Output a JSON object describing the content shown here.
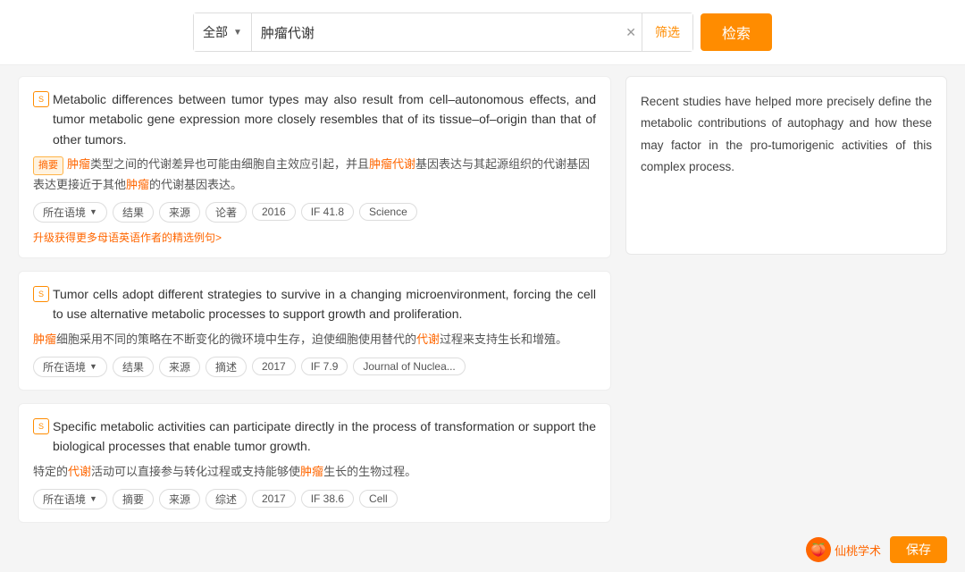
{
  "search": {
    "type_label": "全部",
    "query_value": "肿瘤代谢",
    "filter_label": "筛选",
    "submit_label": "检索"
  },
  "results": [
    {
      "id": 1,
      "icon": "S",
      "english": {
        "parts": [
          {
            "text": "Metabolic",
            "type": "orange"
          },
          {
            "text": " differences between ",
            "type": "normal"
          },
          {
            "text": "tumor",
            "type": "orange"
          },
          {
            "text": " types may also result from cell–autonomous effects, and ",
            "type": "normal"
          },
          {
            "text": "tumor",
            "type": "orange"
          },
          {
            "text": " ",
            "type": "normal"
          },
          {
            "text": "metabolic",
            "type": "orange"
          },
          {
            "text": " gene expression more closely resembles that of its tissue–of–origin than that of other ",
            "type": "normal"
          },
          {
            "text": "tumors.",
            "type": "orange"
          }
        ]
      },
      "chinese": {
        "prefix": "摘要",
        "parts": [
          {
            "text": "肿瘤",
            "type": "orange"
          },
          {
            "text": "类型之间的代谢差异也可能由细胞自主效应引起，并且",
            "type": "normal"
          },
          {
            "text": "肿瘤代谢",
            "type": "orange"
          },
          {
            "text": "基因表达与其起源组织的代谢基因表达更接近于其他",
            "type": "normal"
          },
          {
            "text": "肿瘤",
            "type": "orange"
          },
          {
            "text": "的代谢基因表达。",
            "type": "normal"
          }
        ]
      },
      "tags": [
        {
          "label": "所在语境",
          "has_arrow": true
        },
        {
          "label": "结果",
          "has_arrow": false
        },
        {
          "label": "来源",
          "has_arrow": false
        },
        {
          "label": "论著",
          "has_arrow": false
        },
        {
          "label": "2016",
          "has_arrow": false
        },
        {
          "label": "IF 41.8",
          "has_arrow": false
        },
        {
          "label": "Science",
          "has_arrow": false
        }
      ],
      "upgrade_tip": "升级获得更多母语英语作者的精选例句>"
    },
    {
      "id": 2,
      "icon": "S",
      "english": {
        "parts": [
          {
            "text": "Tumor",
            "type": "orange"
          },
          {
            "text": " cells adopt different strategies to survive in a changing microenvironment, forcing the cell to use alternative ",
            "type": "normal"
          },
          {
            "text": "metabolic processes",
            "type": "orange"
          },
          {
            "text": " to support growth and proliferation.",
            "type": "normal"
          }
        ]
      },
      "chinese": {
        "prefix": null,
        "parts": [
          {
            "text": "肿瘤",
            "type": "orange"
          },
          {
            "text": "细胞采用不同的策略在不断变化的微环境中生存，迫使细胞使用替代的",
            "type": "normal"
          },
          {
            "text": "代谢",
            "type": "orange"
          },
          {
            "text": "过程来支持生长和增殖。",
            "type": "normal"
          }
        ]
      },
      "tags": [
        {
          "label": "所在语境",
          "has_arrow": true
        },
        {
          "label": "结果",
          "has_arrow": false
        },
        {
          "label": "来源",
          "has_arrow": false
        },
        {
          "label": "摘述",
          "has_arrow": false
        },
        {
          "label": "2017",
          "has_arrow": false
        },
        {
          "label": "IF 7.9",
          "has_arrow": false
        },
        {
          "label": "Journal of Nuclea...",
          "has_arrow": false
        }
      ],
      "upgrade_tip": null
    },
    {
      "id": 3,
      "icon": "S",
      "english": {
        "parts": [
          {
            "text": "Specific ",
            "type": "normal"
          },
          {
            "text": "metabolic",
            "type": "orange"
          },
          {
            "text": " activities can participate directly in the ",
            "type": "normal"
          },
          {
            "text": "process",
            "type": "orange"
          },
          {
            "text": " of transformation or support the biological ",
            "type": "normal"
          },
          {
            "text": "processes",
            "type": "orange"
          },
          {
            "text": " that enable ",
            "type": "normal"
          },
          {
            "text": "tumor",
            "type": "orange"
          },
          {
            "text": " growth.",
            "type": "normal"
          }
        ]
      },
      "chinese": {
        "prefix": null,
        "parts": [
          {
            "text": "特定的",
            "type": "normal"
          },
          {
            "text": "代谢",
            "type": "orange"
          },
          {
            "text": "活动可以直接参与转化过程或支持能够使",
            "type": "normal"
          },
          {
            "text": "肿瘤",
            "type": "orange"
          },
          {
            "text": "生长的生物过程。",
            "type": "normal"
          }
        ]
      },
      "tags": [
        {
          "label": "所在语境",
          "has_arrow": true
        },
        {
          "label": "摘要",
          "has_arrow": false
        },
        {
          "label": "来源",
          "has_arrow": false
        },
        {
          "label": "综述",
          "has_arrow": false
        },
        {
          "label": "2017",
          "has_arrow": false
        },
        {
          "label": "IF 38.6",
          "has_arrow": false
        },
        {
          "label": "Cell",
          "has_arrow": false
        }
      ],
      "upgrade_tip": null
    }
  ],
  "right_panel": {
    "text": "Recent studies have helped more precisely define the metabolic contributions of autophagy and how these may factor in the pro-tumorigenic activities of this complex process."
  },
  "branding": {
    "logo_text": "仙桃学术",
    "save_label": "保存"
  }
}
